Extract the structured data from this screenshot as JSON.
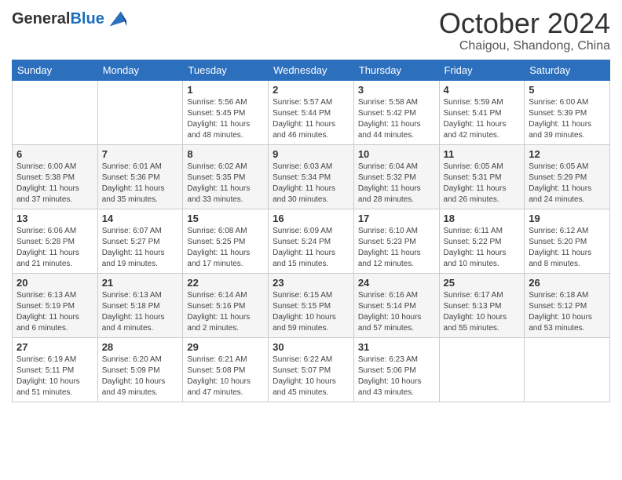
{
  "header": {
    "logo_line1": "General",
    "logo_line2": "Blue",
    "month": "October 2024",
    "location": "Chaigou, Shandong, China"
  },
  "weekdays": [
    "Sunday",
    "Monday",
    "Tuesday",
    "Wednesday",
    "Thursday",
    "Friday",
    "Saturday"
  ],
  "weeks": [
    [
      {
        "day": "",
        "info": ""
      },
      {
        "day": "",
        "info": ""
      },
      {
        "day": "1",
        "info": "Sunrise: 5:56 AM\nSunset: 5:45 PM\nDaylight: 11 hours and 48 minutes."
      },
      {
        "day": "2",
        "info": "Sunrise: 5:57 AM\nSunset: 5:44 PM\nDaylight: 11 hours and 46 minutes."
      },
      {
        "day": "3",
        "info": "Sunrise: 5:58 AM\nSunset: 5:42 PM\nDaylight: 11 hours and 44 minutes."
      },
      {
        "day": "4",
        "info": "Sunrise: 5:59 AM\nSunset: 5:41 PM\nDaylight: 11 hours and 42 minutes."
      },
      {
        "day": "5",
        "info": "Sunrise: 6:00 AM\nSunset: 5:39 PM\nDaylight: 11 hours and 39 minutes."
      }
    ],
    [
      {
        "day": "6",
        "info": "Sunrise: 6:00 AM\nSunset: 5:38 PM\nDaylight: 11 hours and 37 minutes."
      },
      {
        "day": "7",
        "info": "Sunrise: 6:01 AM\nSunset: 5:36 PM\nDaylight: 11 hours and 35 minutes."
      },
      {
        "day": "8",
        "info": "Sunrise: 6:02 AM\nSunset: 5:35 PM\nDaylight: 11 hours and 33 minutes."
      },
      {
        "day": "9",
        "info": "Sunrise: 6:03 AM\nSunset: 5:34 PM\nDaylight: 11 hours and 30 minutes."
      },
      {
        "day": "10",
        "info": "Sunrise: 6:04 AM\nSunset: 5:32 PM\nDaylight: 11 hours and 28 minutes."
      },
      {
        "day": "11",
        "info": "Sunrise: 6:05 AM\nSunset: 5:31 PM\nDaylight: 11 hours and 26 minutes."
      },
      {
        "day": "12",
        "info": "Sunrise: 6:05 AM\nSunset: 5:29 PM\nDaylight: 11 hours and 24 minutes."
      }
    ],
    [
      {
        "day": "13",
        "info": "Sunrise: 6:06 AM\nSunset: 5:28 PM\nDaylight: 11 hours and 21 minutes."
      },
      {
        "day": "14",
        "info": "Sunrise: 6:07 AM\nSunset: 5:27 PM\nDaylight: 11 hours and 19 minutes."
      },
      {
        "day": "15",
        "info": "Sunrise: 6:08 AM\nSunset: 5:25 PM\nDaylight: 11 hours and 17 minutes."
      },
      {
        "day": "16",
        "info": "Sunrise: 6:09 AM\nSunset: 5:24 PM\nDaylight: 11 hours and 15 minutes."
      },
      {
        "day": "17",
        "info": "Sunrise: 6:10 AM\nSunset: 5:23 PM\nDaylight: 11 hours and 12 minutes."
      },
      {
        "day": "18",
        "info": "Sunrise: 6:11 AM\nSunset: 5:22 PM\nDaylight: 11 hours and 10 minutes."
      },
      {
        "day": "19",
        "info": "Sunrise: 6:12 AM\nSunset: 5:20 PM\nDaylight: 11 hours and 8 minutes."
      }
    ],
    [
      {
        "day": "20",
        "info": "Sunrise: 6:13 AM\nSunset: 5:19 PM\nDaylight: 11 hours and 6 minutes."
      },
      {
        "day": "21",
        "info": "Sunrise: 6:13 AM\nSunset: 5:18 PM\nDaylight: 11 hours and 4 minutes."
      },
      {
        "day": "22",
        "info": "Sunrise: 6:14 AM\nSunset: 5:16 PM\nDaylight: 11 hours and 2 minutes."
      },
      {
        "day": "23",
        "info": "Sunrise: 6:15 AM\nSunset: 5:15 PM\nDaylight: 10 hours and 59 minutes."
      },
      {
        "day": "24",
        "info": "Sunrise: 6:16 AM\nSunset: 5:14 PM\nDaylight: 10 hours and 57 minutes."
      },
      {
        "day": "25",
        "info": "Sunrise: 6:17 AM\nSunset: 5:13 PM\nDaylight: 10 hours and 55 minutes."
      },
      {
        "day": "26",
        "info": "Sunrise: 6:18 AM\nSunset: 5:12 PM\nDaylight: 10 hours and 53 minutes."
      }
    ],
    [
      {
        "day": "27",
        "info": "Sunrise: 6:19 AM\nSunset: 5:11 PM\nDaylight: 10 hours and 51 minutes."
      },
      {
        "day": "28",
        "info": "Sunrise: 6:20 AM\nSunset: 5:09 PM\nDaylight: 10 hours and 49 minutes."
      },
      {
        "day": "29",
        "info": "Sunrise: 6:21 AM\nSunset: 5:08 PM\nDaylight: 10 hours and 47 minutes."
      },
      {
        "day": "30",
        "info": "Sunrise: 6:22 AM\nSunset: 5:07 PM\nDaylight: 10 hours and 45 minutes."
      },
      {
        "day": "31",
        "info": "Sunrise: 6:23 AM\nSunset: 5:06 PM\nDaylight: 10 hours and 43 minutes."
      },
      {
        "day": "",
        "info": ""
      },
      {
        "day": "",
        "info": ""
      }
    ]
  ]
}
